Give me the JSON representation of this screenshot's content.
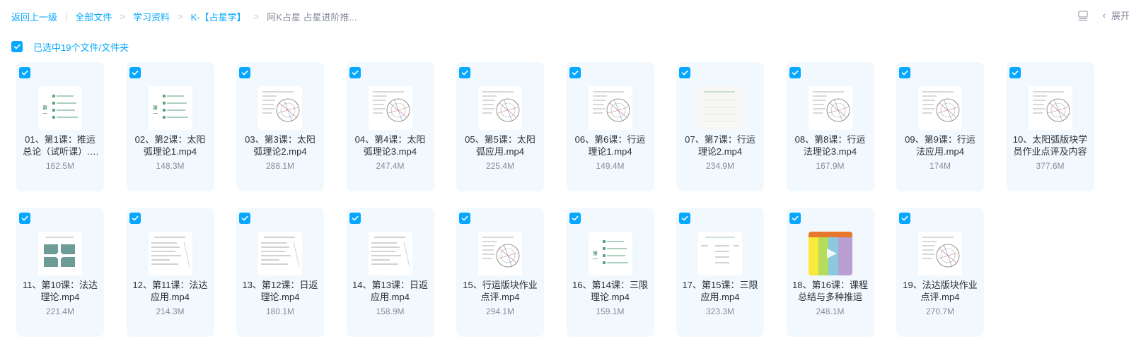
{
  "breadcrumb": {
    "back": "返回上一级",
    "items": [
      "全部文件",
      "学习资料",
      "K-【占星学】"
    ],
    "current": "阿K占星 占星进阶推..."
  },
  "toolbar": {
    "view_icon": "list-view-icon",
    "expand_label": "展开"
  },
  "selection": {
    "label": "已选中19个文件/文件夹"
  },
  "colors": {
    "accent": "#06a7ff",
    "card_bg": "#f1f9fe",
    "muted": "#878c9c"
  },
  "files": [
    {
      "name": "01、第1课：推运总论（试听课）.mp4",
      "size": "162.5M",
      "thumb": "list"
    },
    {
      "name": "02、第2课：太阳弧理论1.mp4",
      "size": "148.3M",
      "thumb": "list"
    },
    {
      "name": "03、第3课：太阳弧理论2.mp4",
      "size": "288.1M",
      "thumb": "chart"
    },
    {
      "name": "04、第4课：太阳弧理论3.mp4",
      "size": "247.4M",
      "thumb": "chart"
    },
    {
      "name": "05、第5课：太阳弧应用.mp4",
      "size": "225.4M",
      "thumb": "chart"
    },
    {
      "name": "06、第6课：行运理论1.mp4",
      "size": "149.4M",
      "thumb": "chart"
    },
    {
      "name": "07、第7课：行运理论2.mp4",
      "size": "234.9M",
      "thumb": "blank"
    },
    {
      "name": "08、第8课：行运法理论3.mp4",
      "size": "167.9M",
      "thumb": "chart"
    },
    {
      "name": "09、第9课：行运法应用.mp4",
      "size": "174M",
      "thumb": "chart"
    },
    {
      "name": "10、太阳弧版块学员作业点评及内容",
      "size": "377.6M",
      "thumb": "chart"
    },
    {
      "name": "11、第10课：法达理论.mp4",
      "size": "221.4M",
      "thumb": "grid"
    },
    {
      "name": "12、第11课：法达应用.mp4",
      "size": "214.3M",
      "thumb": "text"
    },
    {
      "name": "13、第12课：日返理论.mp4",
      "size": "180.1M",
      "thumb": "text"
    },
    {
      "name": "14、第13课：日返应用.mp4",
      "size": "158.9M",
      "thumb": "text"
    },
    {
      "name": "15、行运版块作业点评.mp4",
      "size": "294.1M",
      "thumb": "chart"
    },
    {
      "name": "16、第14课：三限理论.mp4",
      "size": "159.1M",
      "thumb": "list"
    },
    {
      "name": "17、第15课：三限应用.mp4",
      "size": "323.3M",
      "thumb": "table"
    },
    {
      "name": "18、第16课：课程总结与多种推运",
      "size": "248.1M",
      "thumb": "color"
    },
    {
      "name": "19、法达版块作业点评.mp4",
      "size": "270.7M",
      "thumb": "chart"
    }
  ]
}
